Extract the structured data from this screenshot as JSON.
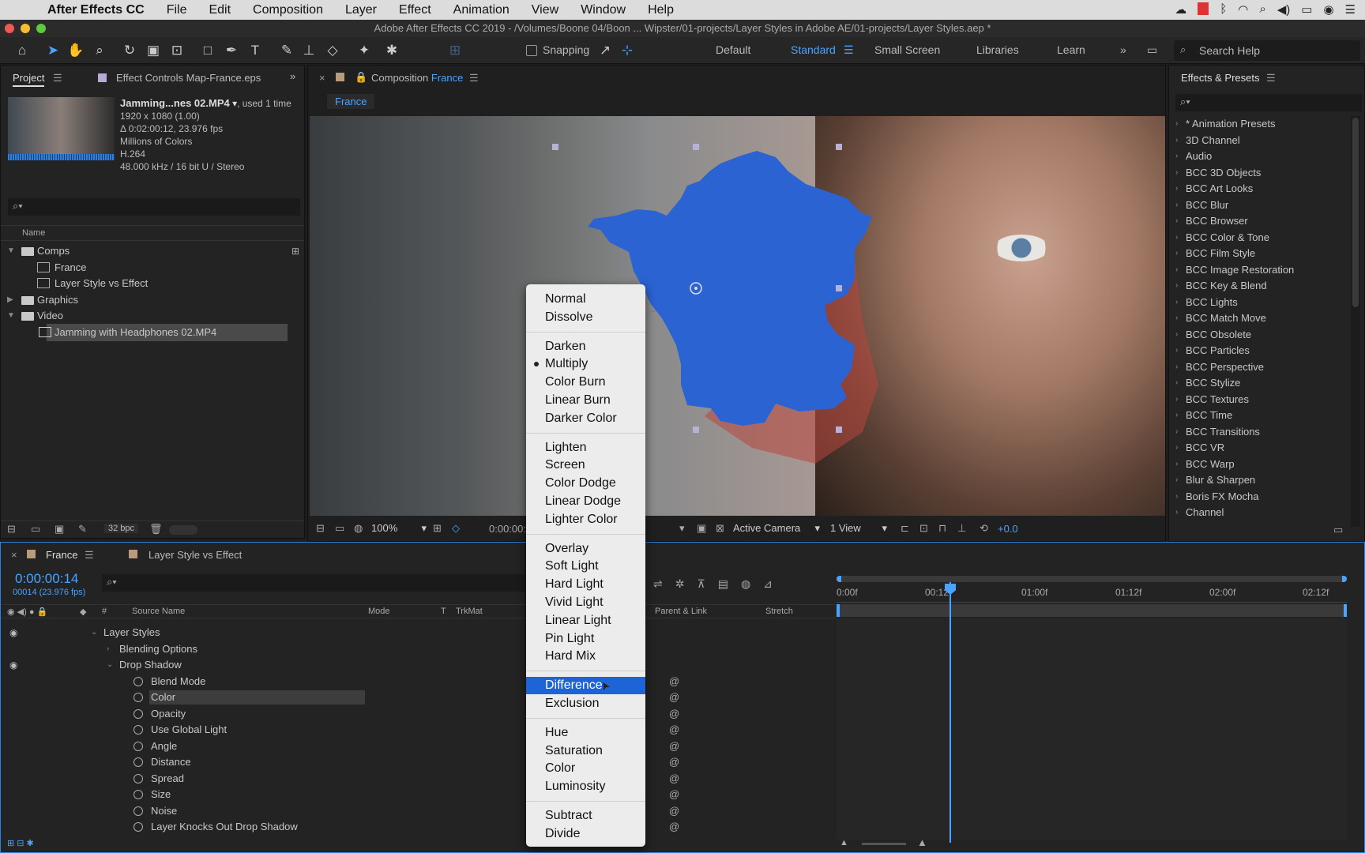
{
  "menubar": {
    "app_name": "After Effects CC",
    "items": [
      "File",
      "Edit",
      "Composition",
      "Layer",
      "Effect",
      "Animation",
      "View",
      "Window",
      "Help"
    ]
  },
  "window_title": "Adobe After Effects CC 2019 - /Volumes/Boone 04/Boon ... Wipster/01-projects/Layer Styles in Adobe AE/01-projects/Layer Styles.aep *",
  "toolbar": {
    "snapping_label": "Snapping",
    "workspaces": [
      "Default",
      "Standard",
      "Small Screen",
      "Libraries",
      "Learn"
    ],
    "active_workspace": "Standard",
    "search_placeholder": "Search Help"
  },
  "project_panel": {
    "tab_project": "Project",
    "tab_effect_controls": "Effect Controls Map-France.eps",
    "footage": {
      "name": "Jamming...nes 02.MP4",
      "used": ", used 1 time",
      "resolution": "1920 x 1080 (1.00)",
      "duration": "Δ 0:02:00:12, 23.976 fps",
      "colors": "Millions of Colors",
      "codec": "H.264",
      "audio": "48.000 kHz / 16 bit U / Stereo"
    },
    "column_name": "Name",
    "tree": [
      {
        "label": "Comps",
        "type": "folder",
        "level": 0,
        "expanded": true
      },
      {
        "label": "France",
        "type": "comp",
        "level": 1
      },
      {
        "label": "Layer Style vs Effect",
        "type": "comp",
        "level": 1
      },
      {
        "label": "Graphics",
        "type": "folder",
        "level": 0,
        "expanded": false
      },
      {
        "label": "Video",
        "type": "folder",
        "level": 0,
        "expanded": true
      },
      {
        "label": "Jamming with Headphones 02.MP4",
        "type": "footage",
        "level": 1,
        "selected": true
      }
    ],
    "bpc": "32 bpc"
  },
  "composition_panel": {
    "tab_label": "Composition",
    "comp_name": "France",
    "breadcrumb": "France",
    "zoom": "100%",
    "timecode": "0:00:00:",
    "camera": "Active Camera",
    "views": "1 View",
    "exposure": "+0.0"
  },
  "effects_panel": {
    "title": "Effects & Presets",
    "items": [
      "* Animation Presets",
      "3D Channel",
      "Audio",
      "BCC 3D Objects",
      "BCC Art Looks",
      "BCC Blur",
      "BCC Browser",
      "BCC Color & Tone",
      "BCC Film Style",
      "BCC Image Restoration",
      "BCC Key & Blend",
      "BCC Lights",
      "BCC Match Move",
      "BCC Obsolete",
      "BCC Particles",
      "BCC Perspective",
      "BCC Stylize",
      "BCC Textures",
      "BCC Time",
      "BCC Transitions",
      "BCC VR",
      "BCC Warp",
      "Blur & Sharpen",
      "Boris FX Mocha",
      "Channel"
    ]
  },
  "timeline": {
    "tab_active": "France",
    "tab_other": "Layer Style vs Effect",
    "timecode": "0:00:00:14",
    "frame_info": "00014 (23.976 fps)",
    "columns": {
      "source": "Source Name",
      "mode": "Mode",
      "t": "T",
      "trkmat": "TrkMat",
      "parent": "Parent & Link",
      "stretch": "Stretch"
    },
    "ruler": [
      "0:00f",
      "00:12f",
      "01:00f",
      "01:12f",
      "02:00f",
      "02:12f"
    ],
    "rows": [
      {
        "label": "Layer Styles",
        "indent": 1,
        "tri": "down",
        "eye": true
      },
      {
        "label": "Blending Options",
        "indent": 2,
        "tri": "right"
      },
      {
        "label": "Drop Shadow",
        "indent": 2,
        "tri": "down",
        "eye": true
      },
      {
        "label": "Blend Mode",
        "indent": 3,
        "stopwatch": true
      },
      {
        "label": "Color",
        "indent": 3,
        "stopwatch": true,
        "highlight": true
      },
      {
        "label": "Opacity",
        "indent": 3,
        "stopwatch": true
      },
      {
        "label": "Use Global Light",
        "indent": 3,
        "stopwatch": true
      },
      {
        "label": "Angle",
        "indent": 3,
        "stopwatch": true
      },
      {
        "label": "Distance",
        "indent": 3,
        "stopwatch": true
      },
      {
        "label": "Spread",
        "indent": 3,
        "stopwatch": true
      },
      {
        "label": "Size",
        "indent": 3,
        "stopwatch": true
      },
      {
        "label": "Noise",
        "indent": 3,
        "stopwatch": true
      },
      {
        "label": "Layer Knocks Out Drop Shadow",
        "indent": 3,
        "stopwatch": true
      }
    ]
  },
  "blend_menu": {
    "groups": [
      [
        "Normal",
        "Dissolve"
      ],
      [
        "Darken",
        "Multiply",
        "Color Burn",
        "Linear Burn",
        "Darker Color"
      ],
      [
        "Lighten",
        "Screen",
        "Color Dodge",
        "Linear Dodge",
        "Lighter Color"
      ],
      [
        "Overlay",
        "Soft Light",
        "Hard Light",
        "Vivid Light",
        "Linear Light",
        "Pin Light",
        "Hard Mix"
      ],
      [
        "Difference",
        "Exclusion"
      ],
      [
        "Hue",
        "Saturation",
        "Color",
        "Luminosity"
      ],
      [
        "Subtract",
        "Divide"
      ]
    ],
    "current": "Multiply",
    "highlighted": "Difference"
  },
  "colors": {
    "accent": "#2d8ceb",
    "menu_highlight": "#1f64d6",
    "map_blue": "#2b63d3"
  }
}
